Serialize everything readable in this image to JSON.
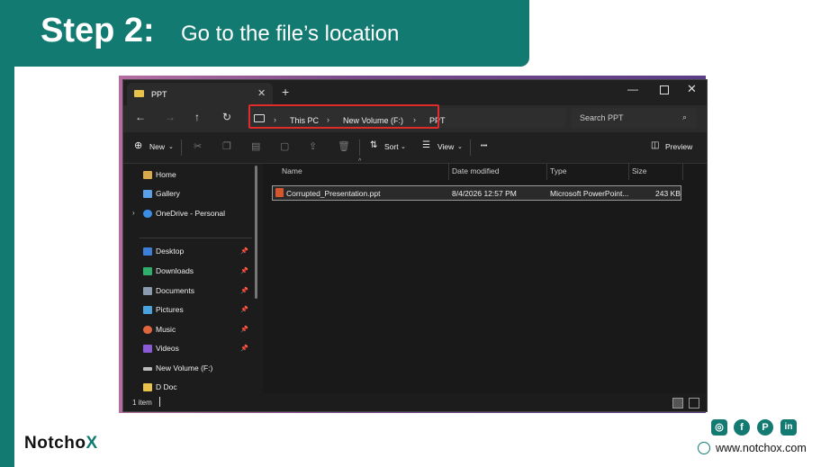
{
  "slide": {
    "step_title": "Step 2:",
    "step_subtitle": "Go to the file’s location"
  },
  "explorer": {
    "tab_title": "PPT",
    "tab_close": "✕",
    "new_tab": "+",
    "window_controls": {
      "minimize": "—",
      "close": "✕"
    },
    "nav": {
      "back": "←",
      "forward": "→",
      "up": "↑",
      "refresh": "↻"
    },
    "breadcrumb": [
      "This PC",
      "New Volume (F:)",
      "PPT"
    ],
    "breadcrumb_sep": "›",
    "search_placeholder": "Search PPT",
    "search_icon": "⌕",
    "toolbar": {
      "new_label": "New",
      "sort_label": "Sort",
      "view_label": "View",
      "more_label": "•••",
      "preview_label": "Preview"
    },
    "sidebar": {
      "items": [
        {
          "label": "Home",
          "icon": "home-icon",
          "color": "#d9a94a"
        },
        {
          "label": "Gallery",
          "icon": "gallery-icon",
          "color": "#5aa0e8"
        },
        {
          "label": "OneDrive - Personal",
          "icon": "cloud-icon",
          "color": "#3a8ee6"
        }
      ],
      "pinned": [
        {
          "label": "Desktop",
          "icon": "desktop-icon",
          "color": "#3b7fd6"
        },
        {
          "label": "Downloads",
          "icon": "download-icon",
          "color": "#2fae6c"
        },
        {
          "label": "Documents",
          "icon": "document-icon",
          "color": "#8a9bb0"
        },
        {
          "label": "Pictures",
          "icon": "pictures-icon",
          "color": "#4aa3df"
        },
        {
          "label": "Music",
          "icon": "music-icon",
          "color": "#e0673d"
        },
        {
          "label": "Videos",
          "icon": "videos-icon",
          "color": "#8a5ad8"
        },
        {
          "label": "New Volume (F:)",
          "icon": "drive-icon",
          "color": "#bbbbbb"
        },
        {
          "label": "D Doc",
          "icon": "folder-icon",
          "color": "#e8c24a"
        }
      ],
      "pin_glyph": "📌"
    },
    "columns": [
      "Name",
      "Date modified",
      "Type",
      "Size"
    ],
    "files": [
      {
        "name": "Corrupted_Presentation.ppt",
        "date": "8/4/2026 12:57 PM",
        "type": "Microsoft PowerPoint...",
        "size": "243 KB"
      }
    ],
    "status": "1 item"
  },
  "footer": {
    "brand_main": "Notch",
    "brand_o": "o",
    "brand_x": "X",
    "social": [
      {
        "icon": "instagram-icon",
        "glyph": "◎"
      },
      {
        "icon": "facebook-icon",
        "glyph": "f"
      },
      {
        "icon": "pinterest-icon",
        "glyph": "P"
      },
      {
        "icon": "linkedin-icon",
        "glyph": "in"
      }
    ],
    "website": "www.notchox.com"
  },
  "colors": {
    "brand_teal": "#137a72",
    "highlight_red": "#e02b2b"
  }
}
